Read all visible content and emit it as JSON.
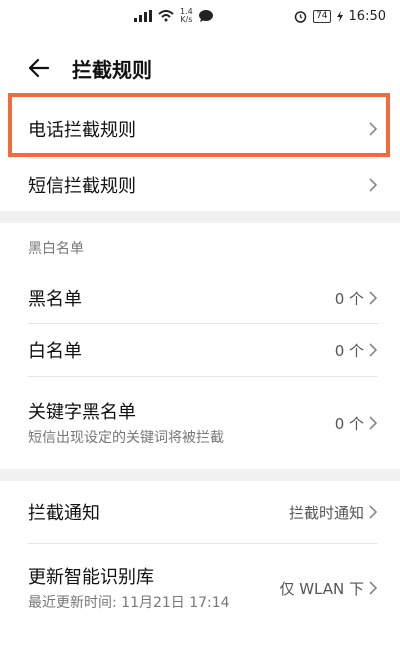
{
  "status_bar": {
    "speed": "1.4",
    "speed_unit": "K/s",
    "battery": "74",
    "time": "16:50"
  },
  "header": {
    "title": "拦截规则"
  },
  "rules": [
    {
      "label": "电话拦截规则"
    },
    {
      "label": "短信拦截规则"
    }
  ],
  "blacklist_section": {
    "title": "黑白名单",
    "items": [
      {
        "label": "黑名单",
        "value": "0 个"
      },
      {
        "label": "白名单",
        "value": "0 个"
      },
      {
        "label": "关键字黑名单",
        "sub": "短信出现设定的关键词将被拦截",
        "value": "0 个"
      }
    ]
  },
  "other": [
    {
      "label": "拦截通知",
      "value": "拦截时通知"
    },
    {
      "label": "更新智能识别库",
      "sub": "最近更新时间: 11月21日 17:14",
      "value": "仅 WLAN 下"
    }
  ],
  "colors": {
    "highlight": "#f06d3b",
    "section_gap": "#f1f1f1"
  }
}
